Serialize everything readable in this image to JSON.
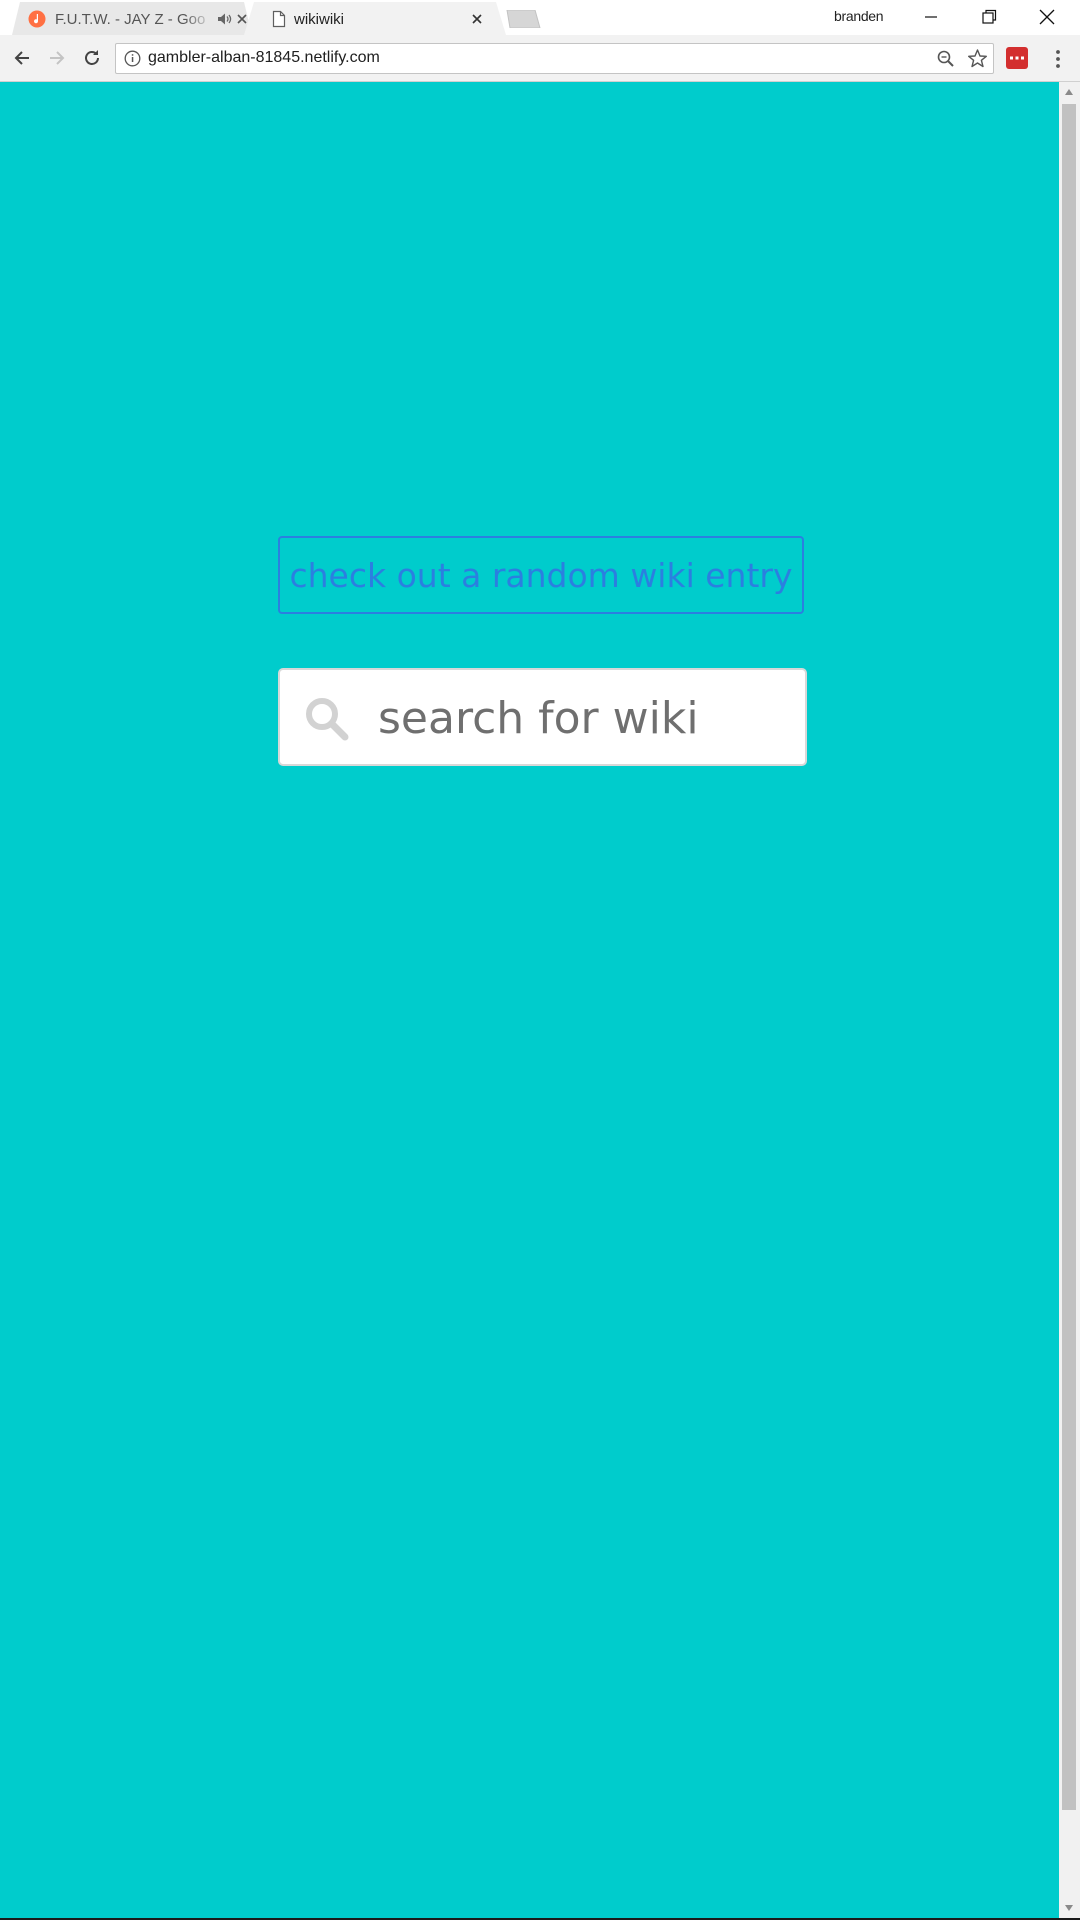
{
  "browser": {
    "tabs": [
      {
        "title": "F.U.T.W. - JAY Z - Goo",
        "active": false,
        "audio": true,
        "favicon": "music-icon"
      },
      {
        "title": "wikiwiki",
        "active": true,
        "audio": false,
        "favicon": "page-icon"
      }
    ],
    "profile_name": "branden",
    "address": "gambler-alban-81845.netlify.com",
    "extension_color": "#d32f2f"
  },
  "page": {
    "background_color": "#00cccc",
    "accent_color": "#2b7fe0",
    "random_button_label": "check out a random wiki entry",
    "search": {
      "placeholder": "search for wiki",
      "value": "",
      "icon": "search-icon"
    }
  }
}
